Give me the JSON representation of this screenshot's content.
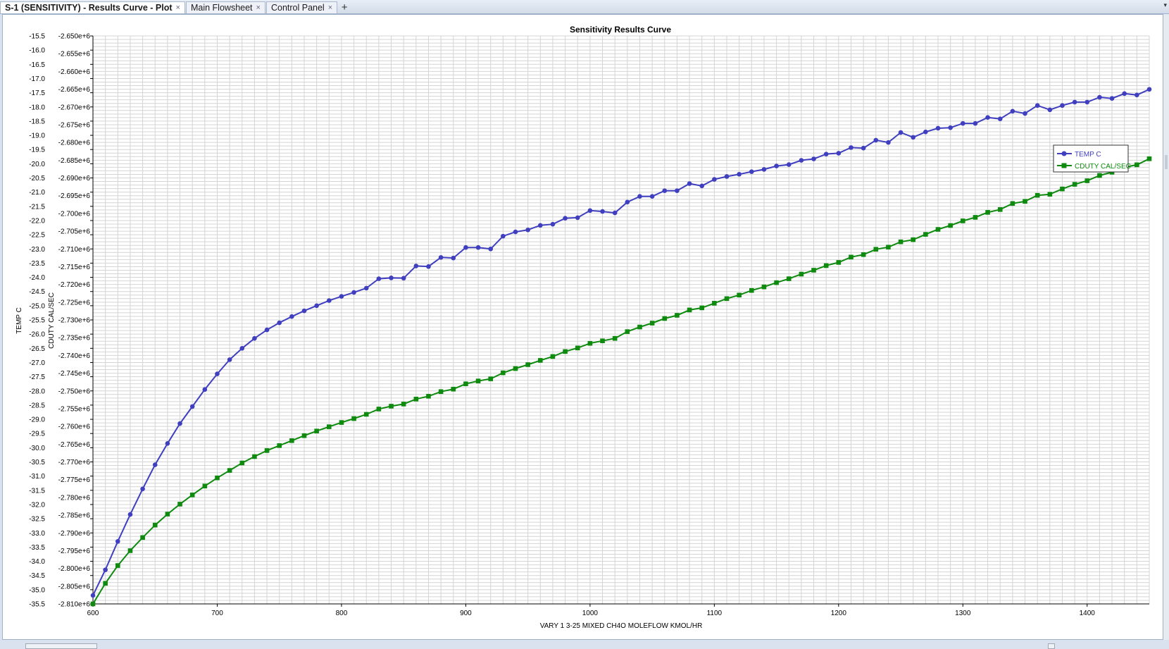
{
  "tabs": [
    {
      "label": "S-1 (SENSITIVITY) - Results Curve - Plot",
      "active": true
    },
    {
      "label": "Main Flowsheet",
      "active": false
    },
    {
      "label": "Control Panel",
      "active": false
    }
  ],
  "icons": {
    "close": "×",
    "add": "+",
    "menu": "▾"
  },
  "colors": {
    "temp": "#3f3fc0",
    "cduty": "#0e8a0e",
    "grid": "#d4d4d4",
    "axis": "#000000"
  },
  "chart_data": {
    "type": "line",
    "title": "Sensitivity Results Curve",
    "xlabel": "VARY   1 3-25 MIXED CH4O MOLEFLOW KMOL/HR",
    "ylabel_left": "TEMP C",
    "ylabel_right": "CDUTY CAL/SEC",
    "xlim": [
      600,
      1450
    ],
    "ylim_left": [
      -35.5,
      -15.5
    ],
    "ylim_right": [
      -2810000,
      -2650000
    ],
    "x_ticks": [
      "600",
      "700",
      "800",
      "900",
      "1000",
      "1100",
      "1200",
      "1300",
      "1400"
    ],
    "x_tick_values": [
      600,
      700,
      800,
      900,
      1000,
      1100,
      1200,
      1300,
      1400
    ],
    "y_ticks_left": [
      "-15.5",
      "-16.0",
      "-16.5",
      "-17.0",
      "-17.5",
      "-18.0",
      "-18.5",
      "-19.0",
      "-19.5",
      "-20.0",
      "-20.5",
      "-21.0",
      "-21.5",
      "-22.0",
      "-22.5",
      "-23.0",
      "-23.5",
      "-24.0",
      "-24.5",
      "-25.0",
      "-25.5",
      "-26.0",
      "-26.5",
      "-27.0",
      "-27.5",
      "-28.0",
      "-28.5",
      "-29.0",
      "-29.5",
      "-30.0",
      "-30.5",
      "-31.0",
      "-31.5",
      "-32.0",
      "-32.5",
      "-33.0",
      "-33.5",
      "-34.0",
      "-34.5",
      "-35.0",
      "-35.5"
    ],
    "y_ticks_right": [
      "-2.650e+6",
      "-2.655e+6",
      "-2.660e+6",
      "-2.665e+6",
      "-2.670e+6",
      "-2.675e+6",
      "-2.680e+6",
      "-2.685e+6",
      "-2.690e+6",
      "-2.695e+6",
      "-2.700e+6",
      "-2.705e+6",
      "-2.710e+6",
      "-2.715e+6",
      "-2.720e+6",
      "-2.725e+6",
      "-2.730e+6",
      "-2.735e+6",
      "-2.740e+6",
      "-2.745e+6",
      "-2.750e+6",
      "-2.755e+6",
      "-2.760e+6",
      "-2.765e+6",
      "-2.770e+6",
      "-2.775e+6",
      "-2.780e+6",
      "-2.785e+6",
      "-2.790e+6",
      "-2.795e+6",
      "-2.800e+6",
      "-2.805e+6",
      "-2.810e+6"
    ],
    "grid": true,
    "legend_position": "right",
    "x": [
      600,
      610,
      620,
      630,
      640,
      650,
      660,
      670,
      680,
      690,
      700,
      710,
      720,
      730,
      740,
      750,
      760,
      770,
      780,
      790,
      800,
      810,
      820,
      830,
      840,
      850,
      860,
      870,
      880,
      890,
      900,
      910,
      920,
      930,
      940,
      950,
      960,
      970,
      980,
      990,
      1000,
      1010,
      1020,
      1030,
      1040,
      1050,
      1060,
      1070,
      1080,
      1090,
      1100,
      1110,
      1120,
      1130,
      1140,
      1150,
      1160,
      1170,
      1180,
      1190,
      1200,
      1210,
      1220,
      1230,
      1240,
      1250,
      1260,
      1270,
      1280,
      1290,
      1300,
      1310,
      1320,
      1330,
      1340,
      1350,
      1360,
      1370,
      1380,
      1390,
      1400,
      1410,
      1420,
      1430,
      1440,
      1450
    ],
    "series": [
      {
        "name": "TEMP C",
        "axis": "left",
        "marker": "circle",
        "values": [
          -35.2,
          -34.3,
          -33.3,
          -32.35,
          -31.45,
          -30.6,
          -29.85,
          -29.15,
          -28.55,
          -27.95,
          -27.4,
          -26.9,
          -26.5,
          -26.15,
          -25.85,
          -25.6,
          -25.38,
          -25.18,
          -25.0,
          -24.82,
          -24.67,
          -24.53,
          -24.38,
          -24.05,
          -24.02,
          -24.03,
          -23.6,
          -23.62,
          -23.3,
          -23.32,
          -22.95,
          -22.95,
          -23.0,
          -22.55,
          -22.4,
          -22.33,
          -22.17,
          -22.13,
          -21.92,
          -21.9,
          -21.65,
          -21.68,
          -21.73,
          -21.35,
          -21.15,
          -21.15,
          -20.95,
          -20.95,
          -20.7,
          -20.78,
          -20.55,
          -20.45,
          -20.37,
          -20.28,
          -20.2,
          -20.08,
          -20.03,
          -19.88,
          -19.83,
          -19.66,
          -19.63,
          -19.43,
          -19.45,
          -19.17,
          -19.25,
          -18.9,
          -19.07,
          -18.88,
          -18.75,
          -18.73,
          -18.58,
          -18.58,
          -18.37,
          -18.42,
          -18.15,
          -18.23,
          -17.95,
          -18.1,
          -17.95,
          -17.83,
          -17.83,
          -17.66,
          -17.7,
          -17.53,
          -17.58,
          -17.38
        ]
      },
      {
        "name": "CDUTY CAL/SEC",
        "axis": "right",
        "marker": "square",
        "values": [
          -2810000,
          -2804200,
          -2799200,
          -2795000,
          -2791300,
          -2787800,
          -2784700,
          -2781900,
          -2779300,
          -2776800,
          -2774500,
          -2772400,
          -2770300,
          -2768500,
          -2766800,
          -2765400,
          -2764000,
          -2762600,
          -2761300,
          -2760100,
          -2758900,
          -2757800,
          -2756600,
          -2755100,
          -2754300,
          -2753700,
          -2752300,
          -2751500,
          -2750200,
          -2749500,
          -2748000,
          -2747200,
          -2746600,
          -2744900,
          -2743700,
          -2742600,
          -2741400,
          -2740300,
          -2738900,
          -2737900,
          -2736600,
          -2735900,
          -2735200,
          -2733300,
          -2732000,
          -2730900,
          -2729600,
          -2728700,
          -2727200,
          -2726600,
          -2725300,
          -2724000,
          -2723000,
          -2721700,
          -2720700,
          -2719500,
          -2718400,
          -2717100,
          -2716000,
          -2714700,
          -2713800,
          -2712300,
          -2711600,
          -2710100,
          -2709500,
          -2708000,
          -2707400,
          -2705900,
          -2704500,
          -2703400,
          -2702100,
          -2701100,
          -2699700,
          -2698900,
          -2697200,
          -2696600,
          -2694900,
          -2694600,
          -2693100,
          -2691800,
          -2690800,
          -2689300,
          -2688400,
          -2687000,
          -2686300,
          -2684600
        ]
      }
    ]
  }
}
